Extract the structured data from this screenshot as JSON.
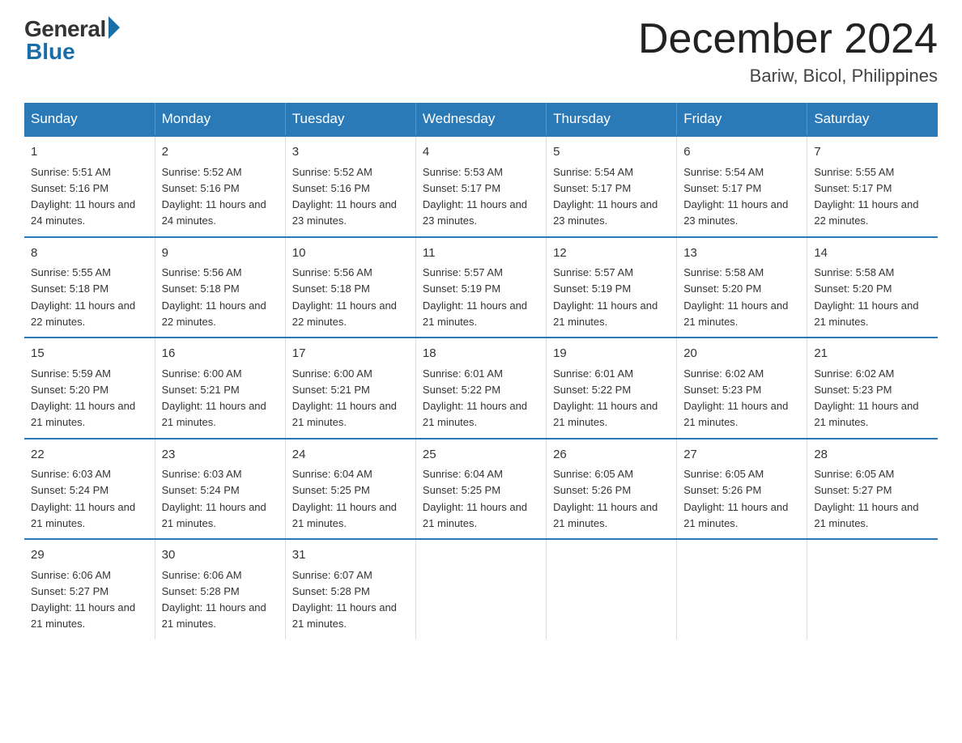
{
  "logo": {
    "general": "General",
    "blue": "Blue"
  },
  "title": "December 2024",
  "subtitle": "Bariw, Bicol, Philippines",
  "days_header": [
    "Sunday",
    "Monday",
    "Tuesday",
    "Wednesday",
    "Thursday",
    "Friday",
    "Saturday"
  ],
  "weeks": [
    [
      {
        "num": "1",
        "sunrise": "5:51 AM",
        "sunset": "5:16 PM",
        "daylight": "11 hours and 24 minutes."
      },
      {
        "num": "2",
        "sunrise": "5:52 AM",
        "sunset": "5:16 PM",
        "daylight": "11 hours and 24 minutes."
      },
      {
        "num": "3",
        "sunrise": "5:52 AM",
        "sunset": "5:16 PM",
        "daylight": "11 hours and 23 minutes."
      },
      {
        "num": "4",
        "sunrise": "5:53 AM",
        "sunset": "5:17 PM",
        "daylight": "11 hours and 23 minutes."
      },
      {
        "num": "5",
        "sunrise": "5:54 AM",
        "sunset": "5:17 PM",
        "daylight": "11 hours and 23 minutes."
      },
      {
        "num": "6",
        "sunrise": "5:54 AM",
        "sunset": "5:17 PM",
        "daylight": "11 hours and 23 minutes."
      },
      {
        "num": "7",
        "sunrise": "5:55 AM",
        "sunset": "5:17 PM",
        "daylight": "11 hours and 22 minutes."
      }
    ],
    [
      {
        "num": "8",
        "sunrise": "5:55 AM",
        "sunset": "5:18 PM",
        "daylight": "11 hours and 22 minutes."
      },
      {
        "num": "9",
        "sunrise": "5:56 AM",
        "sunset": "5:18 PM",
        "daylight": "11 hours and 22 minutes."
      },
      {
        "num": "10",
        "sunrise": "5:56 AM",
        "sunset": "5:18 PM",
        "daylight": "11 hours and 22 minutes."
      },
      {
        "num": "11",
        "sunrise": "5:57 AM",
        "sunset": "5:19 PM",
        "daylight": "11 hours and 21 minutes."
      },
      {
        "num": "12",
        "sunrise": "5:57 AM",
        "sunset": "5:19 PM",
        "daylight": "11 hours and 21 minutes."
      },
      {
        "num": "13",
        "sunrise": "5:58 AM",
        "sunset": "5:20 PM",
        "daylight": "11 hours and 21 minutes."
      },
      {
        "num": "14",
        "sunrise": "5:58 AM",
        "sunset": "5:20 PM",
        "daylight": "11 hours and 21 minutes."
      }
    ],
    [
      {
        "num": "15",
        "sunrise": "5:59 AM",
        "sunset": "5:20 PM",
        "daylight": "11 hours and 21 minutes."
      },
      {
        "num": "16",
        "sunrise": "6:00 AM",
        "sunset": "5:21 PM",
        "daylight": "11 hours and 21 minutes."
      },
      {
        "num": "17",
        "sunrise": "6:00 AM",
        "sunset": "5:21 PM",
        "daylight": "11 hours and 21 minutes."
      },
      {
        "num": "18",
        "sunrise": "6:01 AM",
        "sunset": "5:22 PM",
        "daylight": "11 hours and 21 minutes."
      },
      {
        "num": "19",
        "sunrise": "6:01 AM",
        "sunset": "5:22 PM",
        "daylight": "11 hours and 21 minutes."
      },
      {
        "num": "20",
        "sunrise": "6:02 AM",
        "sunset": "5:23 PM",
        "daylight": "11 hours and 21 minutes."
      },
      {
        "num": "21",
        "sunrise": "6:02 AM",
        "sunset": "5:23 PM",
        "daylight": "11 hours and 21 minutes."
      }
    ],
    [
      {
        "num": "22",
        "sunrise": "6:03 AM",
        "sunset": "5:24 PM",
        "daylight": "11 hours and 21 minutes."
      },
      {
        "num": "23",
        "sunrise": "6:03 AM",
        "sunset": "5:24 PM",
        "daylight": "11 hours and 21 minutes."
      },
      {
        "num": "24",
        "sunrise": "6:04 AM",
        "sunset": "5:25 PM",
        "daylight": "11 hours and 21 minutes."
      },
      {
        "num": "25",
        "sunrise": "6:04 AM",
        "sunset": "5:25 PM",
        "daylight": "11 hours and 21 minutes."
      },
      {
        "num": "26",
        "sunrise": "6:05 AM",
        "sunset": "5:26 PM",
        "daylight": "11 hours and 21 minutes."
      },
      {
        "num": "27",
        "sunrise": "6:05 AM",
        "sunset": "5:26 PM",
        "daylight": "11 hours and 21 minutes."
      },
      {
        "num": "28",
        "sunrise": "6:05 AM",
        "sunset": "5:27 PM",
        "daylight": "11 hours and 21 minutes."
      }
    ],
    [
      {
        "num": "29",
        "sunrise": "6:06 AM",
        "sunset": "5:27 PM",
        "daylight": "11 hours and 21 minutes."
      },
      {
        "num": "30",
        "sunrise": "6:06 AM",
        "sunset": "5:28 PM",
        "daylight": "11 hours and 21 minutes."
      },
      {
        "num": "31",
        "sunrise": "6:07 AM",
        "sunset": "5:28 PM",
        "daylight": "11 hours and 21 minutes."
      },
      null,
      null,
      null,
      null
    ]
  ]
}
